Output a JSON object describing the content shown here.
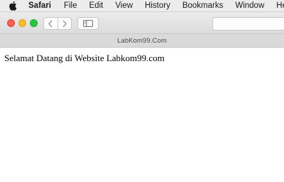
{
  "menubar": {
    "app_name": "Safari",
    "items": [
      "File",
      "Edit",
      "View",
      "History",
      "Bookmarks",
      "Window",
      "Help"
    ]
  },
  "toolbar": {
    "buttons": {
      "back": "chevron-left-icon",
      "forward": "chevron-right-icon",
      "sidebar": "sidebar-icon"
    },
    "address_value": ""
  },
  "tab": {
    "title": "LabKom99.Com"
  },
  "page": {
    "heading": "Selamat Datang di Website Labkom99.com"
  },
  "colors": {
    "close": "#fe5f57",
    "minimize": "#febb2e",
    "zoom": "#28c840"
  }
}
